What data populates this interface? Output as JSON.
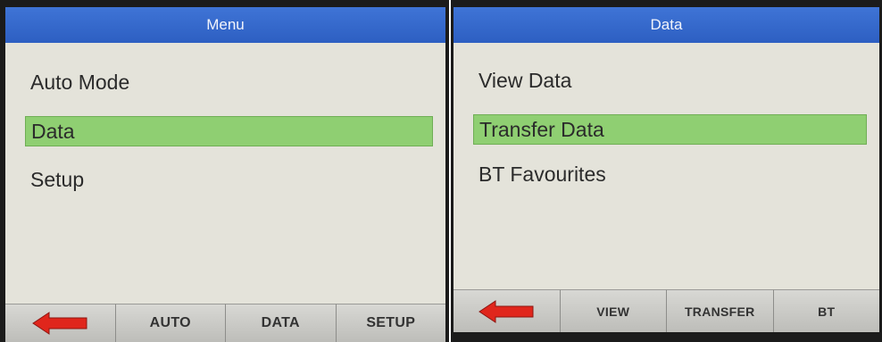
{
  "left_screen": {
    "title": "Menu",
    "items": [
      {
        "label": "Auto Mode",
        "selected": false
      },
      {
        "label": "Data",
        "selected": true
      },
      {
        "label": "Setup",
        "selected": false
      }
    ],
    "softkeys": {
      "back_icon": "left-arrow-icon",
      "auto": "AUTO",
      "data": "DATA",
      "setup": "SETUP"
    }
  },
  "right_screen": {
    "title": "Data",
    "items": [
      {
        "label": "View Data",
        "selected": false
      },
      {
        "label": "Transfer Data",
        "selected": true
      },
      {
        "label": "BT Favourites",
        "selected": false
      }
    ],
    "softkeys": {
      "back_icon": "left-arrow-icon",
      "view": "VIEW",
      "transfer": "TRANSFER",
      "bt": "BT"
    }
  },
  "colors": {
    "title_bar": "#2d5fc2",
    "background": "#e4e3da",
    "selection": "#8fcf72",
    "arrow": "#e0261c"
  }
}
